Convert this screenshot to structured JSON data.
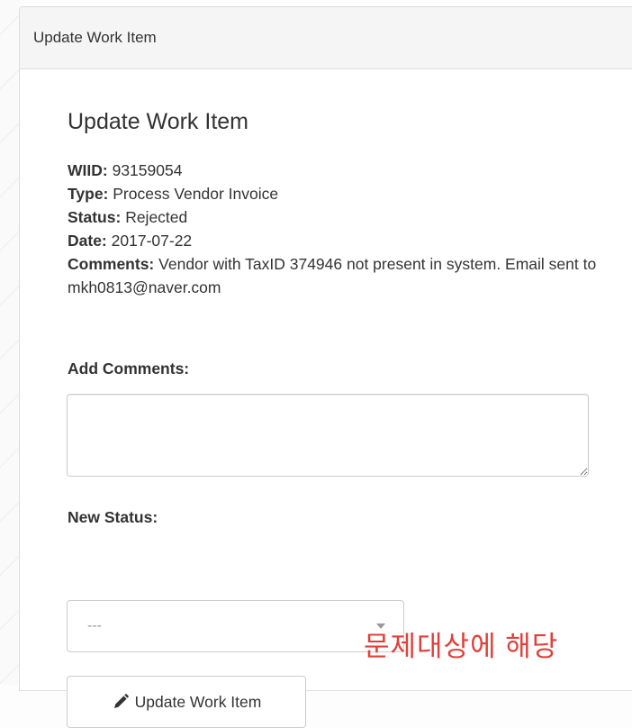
{
  "panel": {
    "heading": "Update Work Item"
  },
  "card": {
    "title": "Update Work Item",
    "fields": [
      {
        "label": "WIID:",
        "value": "93159054"
      },
      {
        "label": "Type:",
        "value": "Process Vendor Invoice"
      },
      {
        "label": "Status:",
        "value": "Rejected"
      },
      {
        "label": "Date:",
        "value": "2017-07-22"
      }
    ],
    "comments": {
      "label": "Comments:",
      "value": "Vendor with TaxID 374946 not present in system. Email sent to mkh0813@naver.com"
    }
  },
  "form": {
    "add_comments_label": "Add Comments:",
    "add_comments_value": "",
    "new_status_label": "New Status:",
    "new_status_selected": "---",
    "submit_label": "Update Work Item",
    "submit_icon": "pencil-icon"
  },
  "annotation": {
    "text": "문제대상에 해당",
    "color": "#e0403a"
  }
}
